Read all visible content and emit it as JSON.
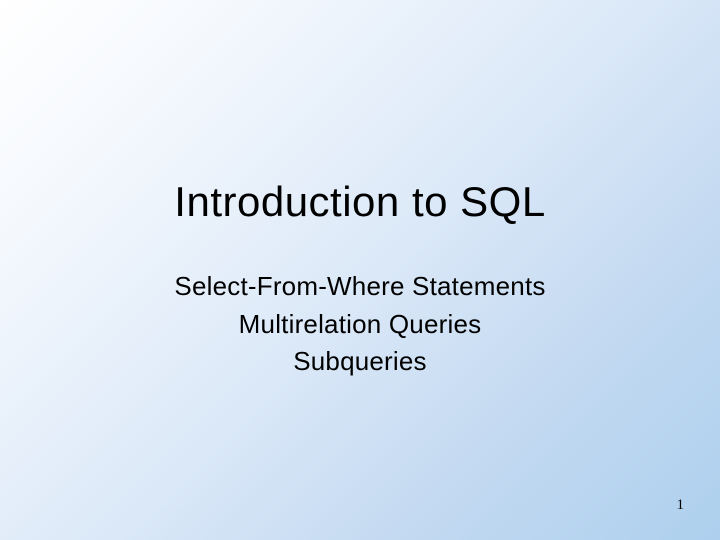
{
  "slide": {
    "title": "Introduction to SQL",
    "subtitles": {
      "line1": "Select-From-Where Statements",
      "line2": "Multirelation Queries",
      "line3": "Subqueries"
    },
    "page_number": "1"
  }
}
